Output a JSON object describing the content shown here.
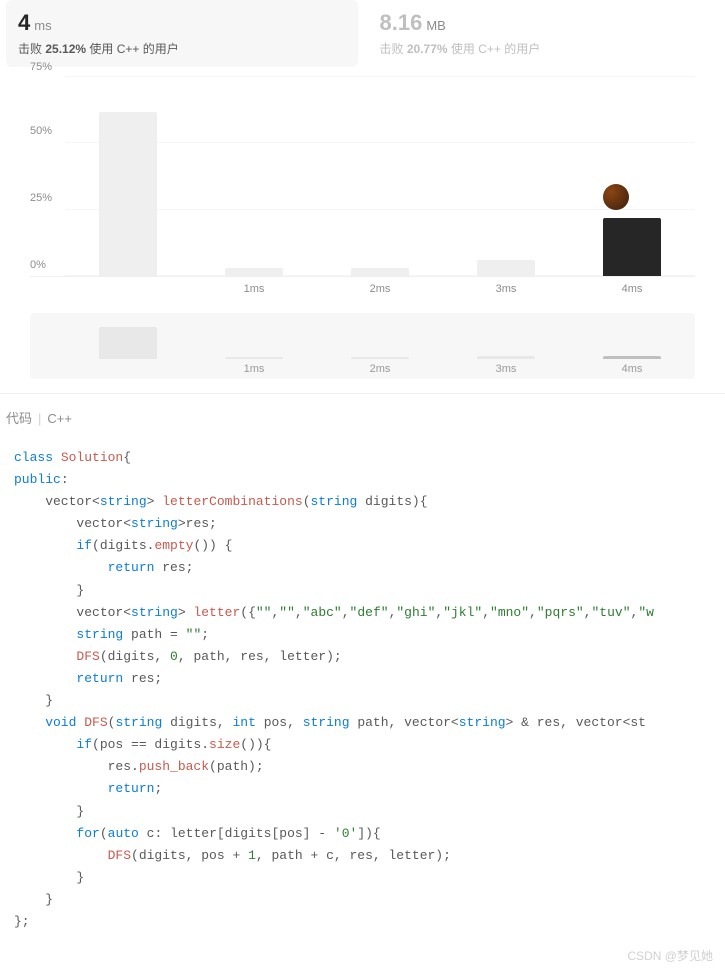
{
  "stats": {
    "time": {
      "value": "4",
      "unit": "ms",
      "beats_prefix": "击败",
      "pct": "25.12%",
      "suffix": "使用 C++ 的用户"
    },
    "memory": {
      "value": "8.16",
      "unit": "MB",
      "beats_prefix": "击败",
      "pct": "20.77%",
      "suffix": "使用 C++ 的用户"
    }
  },
  "chart_data": {
    "type": "bar",
    "ylabel_unit": "%",
    "yticks": [
      "0%",
      "25%",
      "50%",
      "75%"
    ],
    "categories": [
      "",
      "1ms",
      "2ms",
      "3ms",
      "4ms"
    ],
    "values": [
      62,
      3,
      3,
      6,
      22
    ],
    "highlight_index": 4,
    "ylim": [
      0,
      75
    ]
  },
  "mini_chart": {
    "categories": [
      "",
      "1ms",
      "2ms",
      "3ms",
      "4ms"
    ],
    "values": [
      32,
      2,
      2,
      3,
      3
    ],
    "highlight_index": 4
  },
  "code_header": {
    "label1": "代码",
    "label2": "C++"
  },
  "code": {
    "l1a": "class",
    "l1b": "Solution",
    "l1c": "{",
    "l2a": "public",
    "l2b": ":",
    "l3a": "    vector<",
    "l3b": "string",
    "l3c": "> ",
    "l3d": "letterCombinations",
    "l3e": "(",
    "l3f": "string",
    "l3g": " digits){",
    "l4a": "        vector<",
    "l4b": "string",
    "l4c": ">res;",
    "l5a": "        if",
    "l5b": "(digits.",
    "l5c": "empty",
    "l5d": "()) {",
    "l6a": "            return",
    "l6b": " res;",
    "l7": "        }",
    "l8a": "        vector<",
    "l8b": "string",
    "l8c": "> ",
    "l8d": "letter",
    "l8e": "({",
    "l8f": "\"\"",
    "l8g": ",",
    "l8h": "\"\"",
    "l8i": ",",
    "l8j": "\"abc\"",
    "l8k": ",",
    "l8l": "\"def\"",
    "l8m": ",",
    "l8n": "\"ghi\"",
    "l8o": ",",
    "l8p": "\"jkl\"",
    "l8q": ",",
    "l8r": "\"mno\"",
    "l8s": ",",
    "l8t": "\"pqrs\"",
    "l8u": ",",
    "l8v": "\"tuv\"",
    "l8w": ",",
    "l8x": "\"w",
    "l9a": "        string",
    "l9b": " path = ",
    "l9c": "\"\"",
    "l9d": ";",
    "l10a": "        DFS",
    "l10b": "(digits, ",
    "l10c": "0",
    "l10d": ", path, res, letter);",
    "l11a": "        return",
    "l11b": " res;",
    "l12": "    }",
    "l13a": "    void",
    "l13b": " ",
    "l13c": "DFS",
    "l13d": "(",
    "l13e": "string",
    "l13f": " digits, ",
    "l13g": "int",
    "l13h": " pos, ",
    "l13i": "string",
    "l13j": " path, vector<",
    "l13k": "string",
    "l13l": "> & res, vector<st",
    "l14a": "        if",
    "l14b": "(pos == digits.",
    "l14c": "size",
    "l14d": "()){",
    "l15a": "            res.",
    "l15b": "push_back",
    "l15c": "(path);",
    "l16a": "            return",
    "l16b": ";",
    "l17": "        }",
    "l18a": "        for",
    "l18b": "(",
    "l18c": "auto",
    "l18d": " c: letter[digits[pos] - ",
    "l18e": "'0'",
    "l18f": "]){",
    "l19a": "            DFS",
    "l19b": "(digits, pos + ",
    "l19c": "1",
    "l19d": ", path + c, res, letter);",
    "l20": "        }",
    "l21": "    }",
    "l22": "};"
  },
  "watermark": "CSDN @梦见她"
}
